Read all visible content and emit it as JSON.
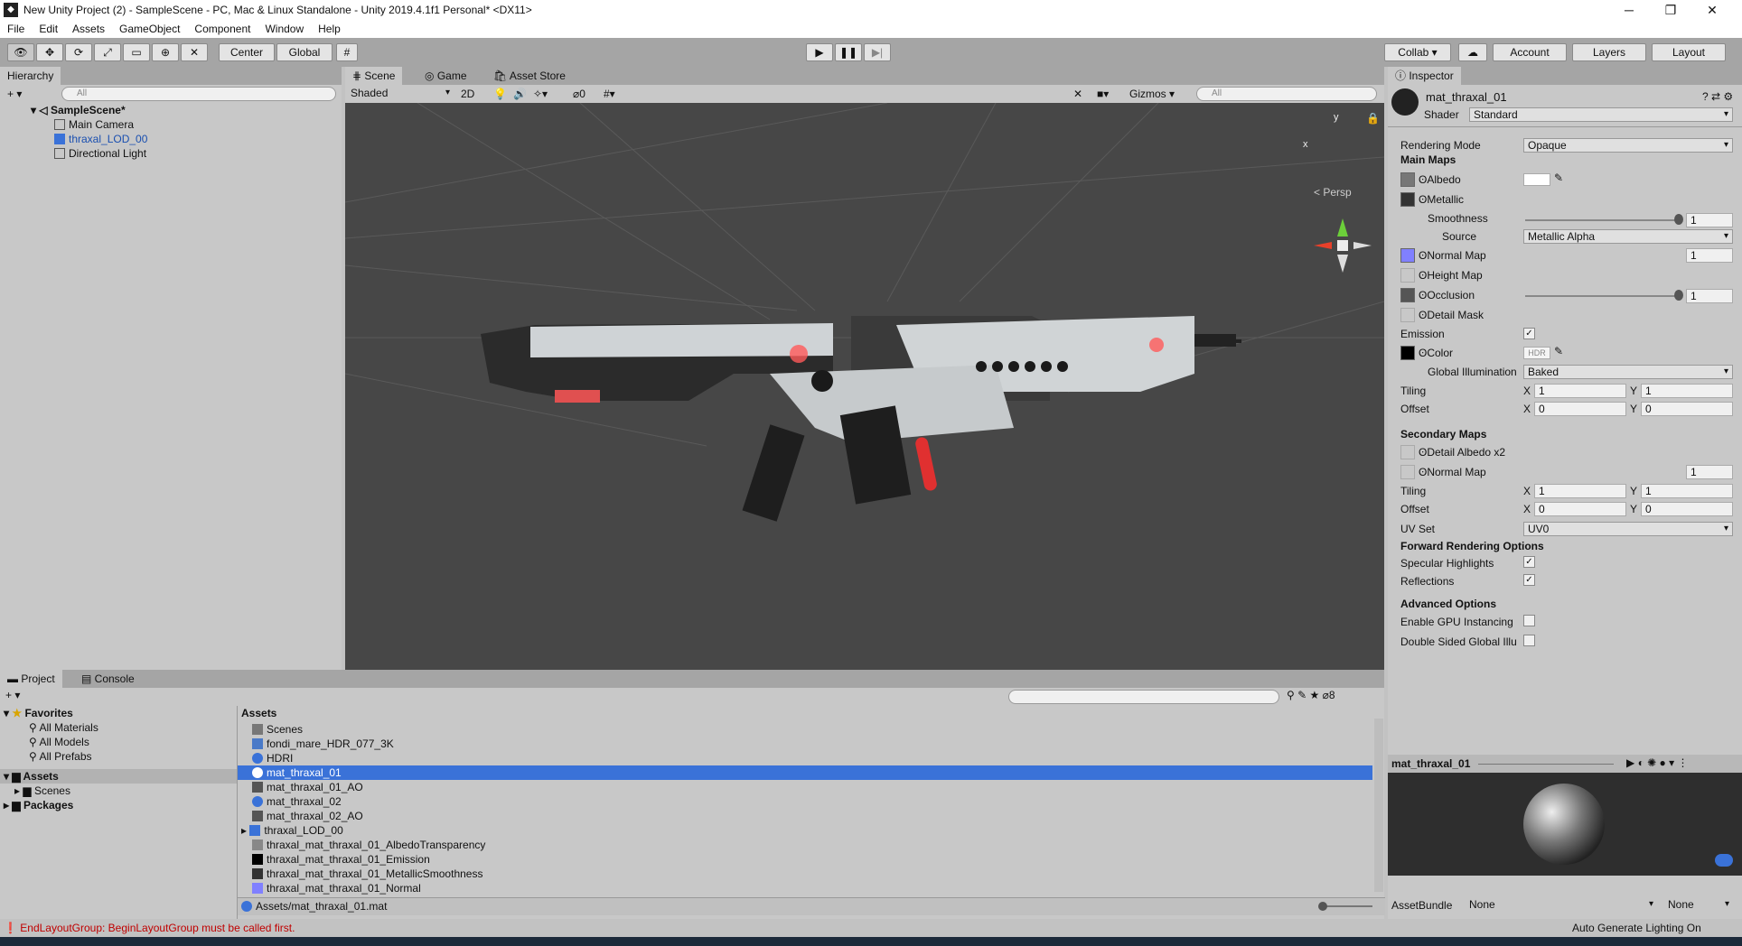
{
  "window": {
    "title": "New Unity Project (2) - SampleScene - PC, Mac & Linux Standalone - Unity 2019.4.1f1 Personal* <DX11>",
    "min": "─",
    "max": "❐",
    "close": "✕"
  },
  "menu": [
    "File",
    "Edit",
    "Assets",
    "GameObject",
    "Component",
    "Window",
    "Help"
  ],
  "toolbar": {
    "pivot": "Center",
    "space": "Global",
    "collab": "Collab ▾",
    "account": "Account",
    "layers": "Layers",
    "layout": "Layout"
  },
  "hierarchy": {
    "tab": "Hierarchy",
    "search_placeholder": "All",
    "scene": "SampleScene*",
    "items": [
      "Main Camera",
      "thraxal_LOD_00",
      "Directional Light"
    ]
  },
  "scene_view": {
    "tabs": [
      "Scene",
      "Game",
      "Asset Store"
    ],
    "shading": "Shaded",
    "mode2d": "2D",
    "hidden_count": "0",
    "gizmos": "Gizmos",
    "search_placeholder": "All",
    "persp": "< Persp",
    "axis_x": "x",
    "axis_y": "y"
  },
  "inspector": {
    "tab": "Inspector",
    "material": "mat_thraxal_01",
    "shader_label": "Shader",
    "shader": "Standard",
    "rendering_mode_label": "Rendering Mode",
    "rendering_mode": "Opaque",
    "main_maps": "Main Maps",
    "albedo": "Albedo",
    "metallic": "Metallic",
    "smoothness": "Smoothness",
    "smoothness_val": "1",
    "smoothness_level": 1.0,
    "source": "Source",
    "source_val": "Metallic Alpha",
    "normal_map": "Normal Map",
    "normal_val": "1",
    "height_map": "Height Map",
    "occlusion": "Occlusion",
    "occlusion_val": "1",
    "occlusion_level": 1.0,
    "detail_mask": "Detail Mask",
    "emission": "Emission",
    "color": "Color",
    "hdr": "HDR",
    "gi": "Global Illumination",
    "gi_val": "Baked",
    "tiling": "Tiling",
    "offset": "Offset",
    "x": "X",
    "y": "Y",
    "tile_x": "1",
    "tile_y": "1",
    "off_x": "0",
    "off_y": "0",
    "secondary_maps": "Secondary Maps",
    "detail_albedo": "Detail Albedo x2",
    "normal_map2": "Normal Map",
    "normal2_val": "1",
    "tiling2_x": "1",
    "tiling2_y": "1",
    "offset2_x": "0",
    "offset2_y": "0",
    "uv_set": "UV Set",
    "uv_set_val": "UV0",
    "forward": "Forward Rendering Options",
    "specular": "Specular Highlights",
    "reflections": "Reflections",
    "advanced": "Advanced Options",
    "gpu": "Enable GPU Instancing",
    "double_sided": "Double Sided Global Illu",
    "preview_title": "mat_thraxal_01",
    "assetbundle": "AssetBundle",
    "ab_none1": "None",
    "ab_none2": "None",
    "auto_lighting": "Auto Generate Lighting On"
  },
  "project": {
    "tabs": [
      "Project",
      "Console"
    ],
    "hidden": "8",
    "favorites": "Favorites",
    "fav_items": [
      "All Materials",
      "All Models",
      "All Prefabs"
    ],
    "assets": "Assets",
    "assets_children": [
      "Scenes"
    ],
    "packages": "Packages",
    "header": "Assets",
    "files": [
      "Scenes",
      "fondi_mare_HDR_077_3K",
      "HDRI",
      "mat_thraxal_01",
      "mat_thraxal_01_AO",
      "mat_thraxal_02",
      "mat_thraxal_02_AO",
      "thraxal_LOD_00",
      "thraxal_mat_thraxal_01_AlbedoTransparency",
      "thraxal_mat_thraxal_01_Emission",
      "thraxal_mat_thraxal_01_MetallicSmoothness",
      "thraxal_mat_thraxal_01_Normal"
    ],
    "path": "Assets/mat_thraxal_01.mat"
  },
  "status": {
    "error": "EndLayoutGroup: BeginLayoutGroup must be called first."
  },
  "colors": {
    "selection": "#3a72d8",
    "scene_bg": "#474747",
    "error": "#c00000"
  }
}
